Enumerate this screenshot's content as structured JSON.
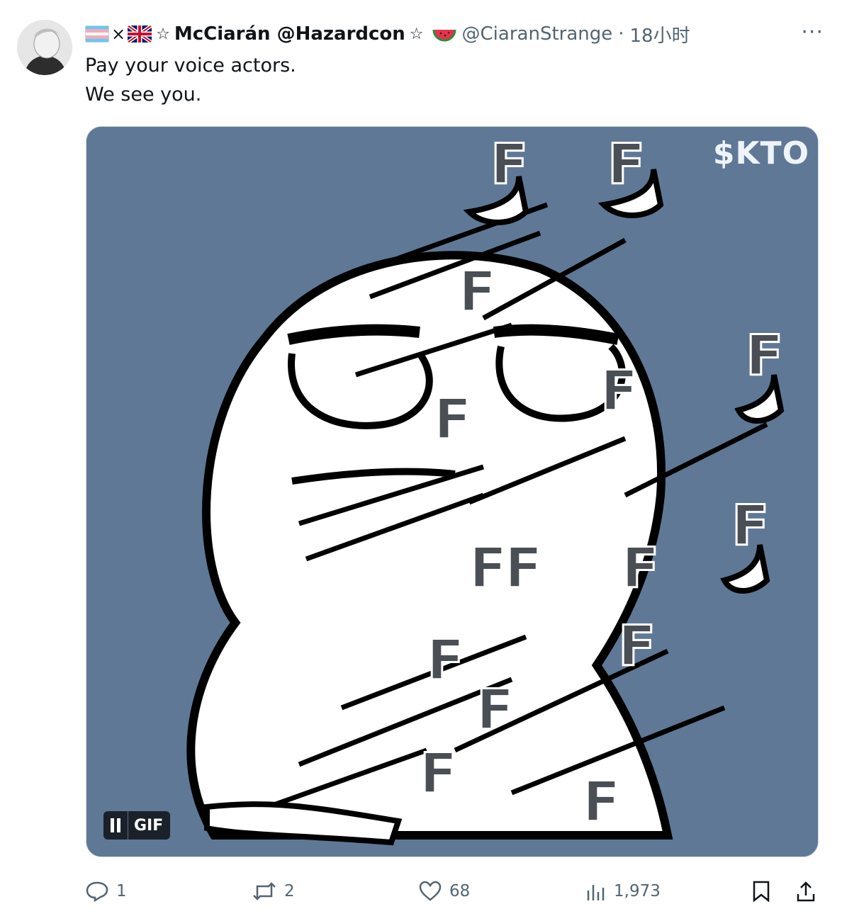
{
  "tweet": {
    "display_name": "McCiarán @Hazardcon",
    "handle": "@CiaranStrange",
    "separator": "·",
    "time": "18小时",
    "more_label": "···",
    "lines": [
      "Pay your voice actors.",
      "We see you."
    ],
    "media": {
      "watermark": "$KTO",
      "badge_label": "GIF"
    },
    "actions": {
      "replies": "1",
      "retweets": "2",
      "likes": "68",
      "views": "1,973"
    }
  },
  "icons": {
    "avatar": "avatar",
    "flags": [
      "transgender-flag-icon",
      "uk-flag-icon"
    ],
    "stars": "star-icon",
    "melon": "watermelon-icon",
    "reply": "reply-icon",
    "retweet": "retweet-icon",
    "like": "heart-icon",
    "views": "views-chart-icon",
    "bookmark": "bookmark-icon",
    "share": "share-icon"
  },
  "colors": {
    "media_background": "#5f7896",
    "secondary_text": "#536471",
    "primary_text": "#0f1419"
  }
}
